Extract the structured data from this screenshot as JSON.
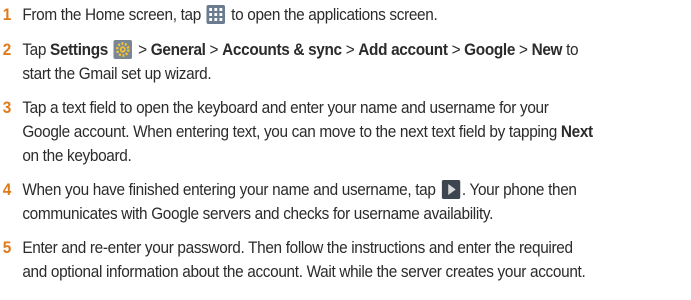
{
  "colors": {
    "step_number": "#e07a1b",
    "text": "#2b2b2b"
  },
  "steps": [
    {
      "number": "1",
      "before_icon": "From the Home screen, tap",
      "icon": "apps-grid-icon",
      "after_icon": "to open the applications screen."
    },
    {
      "number": "2",
      "tap": "Tap",
      "settings": "Settings",
      "icon": "settings-gear-icon",
      "sep1": ">",
      "general": "General",
      "sep2": ">",
      "accounts_sync": "Accounts & sync",
      "sep3": ">",
      "add_account": "Add account",
      "sep4": ">",
      "google": "Google",
      "sep5": ">",
      "new": "New",
      "to": "to",
      "line2": "start the Gmail set up wizard."
    },
    {
      "number": "3",
      "line1": "Tap a text field to open the keyboard and enter your name and username for your",
      "line2": "Google account. When entering text, you can move to the next text field by tapping",
      "next": "Next",
      "line3": "on the keyboard."
    },
    {
      "number": "4",
      "before_icon": "When you have finished entering your name and username, tap",
      "icon": "next-arrow-icon",
      "after_icon": ". Your phone then",
      "line2": "communicates with Google servers and checks for username availability."
    },
    {
      "number": "5",
      "line1": "Enter and re-enter your password. Then follow the instructions and enter the required",
      "line2": "and optional information about the account. Wait while the server creates your account."
    }
  ]
}
